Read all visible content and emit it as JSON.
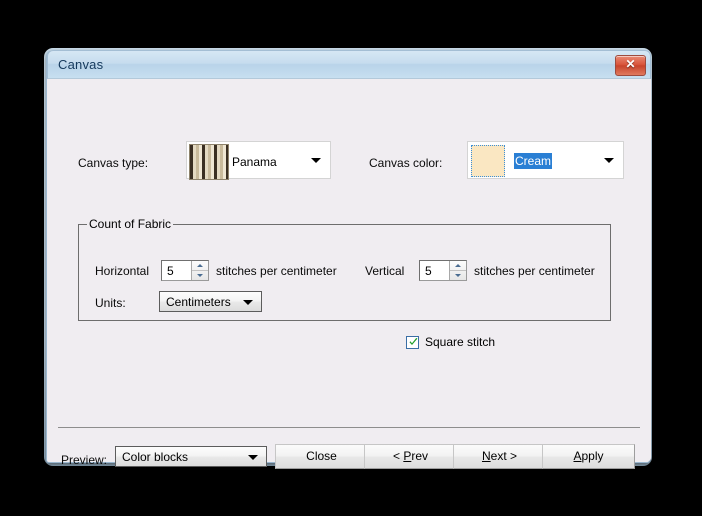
{
  "window": {
    "title": "Canvas",
    "close_icon": "close-icon",
    "close_glyph": "✕"
  },
  "form": {
    "canvas_type_label": "Canvas type:",
    "canvas_type_value": "Panama",
    "canvas_type_swatch": "panama-weave-swatch",
    "canvas_color_label": "Canvas color:",
    "canvas_color_value": "Cream",
    "canvas_color_hex": "#fae7c2",
    "canvas_color_selected": true
  },
  "count_of_fabric": {
    "legend": "Count of Fabric",
    "horizontal_label": "Horizontal",
    "horizontal_value": "5",
    "horizontal_units": "stitches per centimeter",
    "vertical_label": "Vertical",
    "vertical_value": "5",
    "vertical_units": "stitches per centimeter",
    "units_label": "Units:",
    "units_value": "Centimeters",
    "square_stitch_label": "Square stitch",
    "square_stitch_checked": true
  },
  "footer": {
    "preview_label": "Preview:",
    "preview_value": "Color blocks",
    "buttons": [
      {
        "name": "close",
        "pre": "",
        "accel": "",
        "post": "Close"
      },
      {
        "name": "prev",
        "pre": "< ",
        "accel": "P",
        "post": "rev"
      },
      {
        "name": "next",
        "pre": "",
        "accel": "N",
        "post": "ext >"
      },
      {
        "name": "apply",
        "pre": "",
        "accel": "A",
        "post": "pply"
      }
    ]
  },
  "colors": {
    "dialog_background": "#f0edf1",
    "title_bar": "#c6dcee",
    "accent_selection": "#2a7fd4",
    "close_red": "#d9563c",
    "checkmark_green": "#1f9e28"
  }
}
